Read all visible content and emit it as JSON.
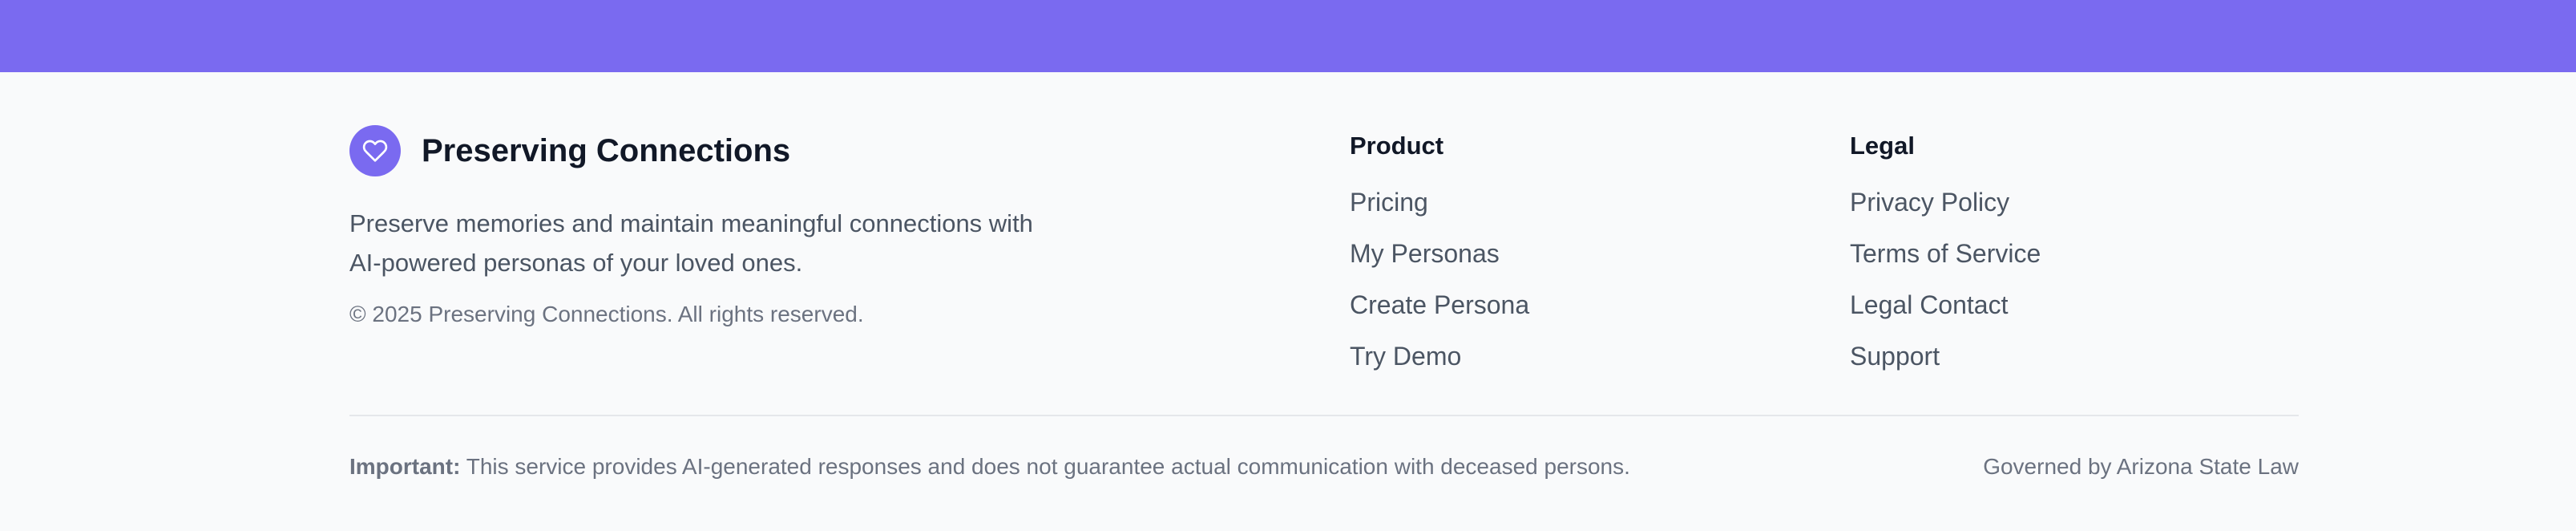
{
  "colors": {
    "accent": "#7a6af0",
    "background": "#f9fafb",
    "heading": "#111827",
    "body_text": "#4b5563",
    "muted_text": "#6b7280",
    "divider": "#e5e7eb"
  },
  "brand": {
    "icon": "heart-icon",
    "name": "Preserving Connections",
    "tagline": "Preserve memories and maintain meaningful connections with AI-powered personas of your loved ones.",
    "copyright": "© 2025 Preserving Connections. All rights reserved."
  },
  "product": {
    "title": "Product",
    "links": [
      "Pricing",
      "My Personas",
      "Create Persona",
      "Try Demo"
    ]
  },
  "legal": {
    "title": "Legal",
    "links": [
      "Privacy Policy",
      "Terms of Service",
      "Legal Contact",
      "Support"
    ]
  },
  "notice": {
    "label": "Important:",
    "text": " This service provides AI-generated responses and does not guarantee actual communication with deceased persons.",
    "jurisdiction": "Governed by Arizona State Law"
  }
}
